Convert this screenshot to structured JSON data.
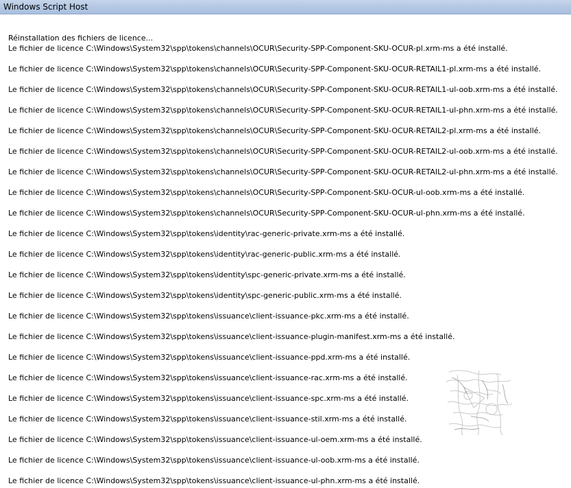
{
  "window": {
    "title": "Windows Script Host"
  },
  "output": {
    "heading": "Réinstallation des fichiers de licence...",
    "lines": [
      "Le fichier de licence C:\\Windows\\System32\\spp\\tokens\\channels\\OCUR\\Security-SPP-Component-SKU-OCUR-pl.xrm-ms a été installé.",
      "Le fichier de licence C:\\Windows\\System32\\spp\\tokens\\channels\\OCUR\\Security-SPP-Component-SKU-OCUR-RETAIL1-pl.xrm-ms a été installé.",
      "Le fichier de licence C:\\Windows\\System32\\spp\\tokens\\channels\\OCUR\\Security-SPP-Component-SKU-OCUR-RETAIL1-ul-oob.xrm-ms a été installé.",
      "Le fichier de licence C:\\Windows\\System32\\spp\\tokens\\channels\\OCUR\\Security-SPP-Component-SKU-OCUR-RETAIL1-ul-phn.xrm-ms a été installé.",
      "Le fichier de licence C:\\Windows\\System32\\spp\\tokens\\channels\\OCUR\\Security-SPP-Component-SKU-OCUR-RETAIL2-pl.xrm-ms a été installé.",
      "Le fichier de licence C:\\Windows\\System32\\spp\\tokens\\channels\\OCUR\\Security-SPP-Component-SKU-OCUR-RETAIL2-ul-oob.xrm-ms a été installé.",
      "Le fichier de licence C:\\Windows\\System32\\spp\\tokens\\channels\\OCUR\\Security-SPP-Component-SKU-OCUR-RETAIL2-ul-phn.xrm-ms a été installé.",
      "Le fichier de licence C:\\Windows\\System32\\spp\\tokens\\channels\\OCUR\\Security-SPP-Component-SKU-OCUR-ul-oob.xrm-ms a été installé.",
      "Le fichier de licence C:\\Windows\\System32\\spp\\tokens\\channels\\OCUR\\Security-SPP-Component-SKU-OCUR-ul-phn.xrm-ms a été installé.",
      "Le fichier de licence C:\\Windows\\System32\\spp\\tokens\\identity\\rac-generic-private.xrm-ms a été installé.",
      "Le fichier de licence C:\\Windows\\System32\\spp\\tokens\\identity\\rac-generic-public.xrm-ms a été installé.",
      "Le fichier de licence C:\\Windows\\System32\\spp\\tokens\\identity\\spc-generic-private.xrm-ms a été installé.",
      "Le fichier de licence C:\\Windows\\System32\\spp\\tokens\\identity\\spc-generic-public.xrm-ms a été installé.",
      "Le fichier de licence C:\\Windows\\System32\\spp\\tokens\\issuance\\client-issuance-pkc.xrm-ms a été installé.",
      "Le fichier de licence C:\\Windows\\System32\\spp\\tokens\\issuance\\client-issuance-plugin-manifest.xrm-ms a été installé.",
      "Le fichier de licence C:\\Windows\\System32\\spp\\tokens\\issuance\\client-issuance-ppd.xrm-ms a été installé.",
      "Le fichier de licence C:\\Windows\\System32\\spp\\tokens\\issuance\\client-issuance-rac.xrm-ms a été installé.",
      "Le fichier de licence C:\\Windows\\System32\\spp\\tokens\\issuance\\client-issuance-spc.xrm-ms a été installé.",
      "Le fichier de licence C:\\Windows\\System32\\spp\\tokens\\issuance\\client-issuance-stil.xrm-ms a été installé.",
      "Le fichier de licence C:\\Windows\\System32\\spp\\tokens\\issuance\\client-issuance-ul-oem.xrm-ms a été installé.",
      "Le fichier de licence C:\\Windows\\System32\\spp\\tokens\\issuance\\client-issuance-ul-oob.xrm-ms a été installé.",
      "Le fichier de licence C:\\Windows\\System32\\spp\\tokens\\issuance\\client-issuance-ul-phn.xrm-ms a été installé."
    ]
  },
  "decor": {
    "watermark_icon": "sketch-watermark-icon"
  },
  "colors": {
    "titlebar": "#b5c9e4",
    "text": "#000000",
    "background": "#ffffff"
  }
}
